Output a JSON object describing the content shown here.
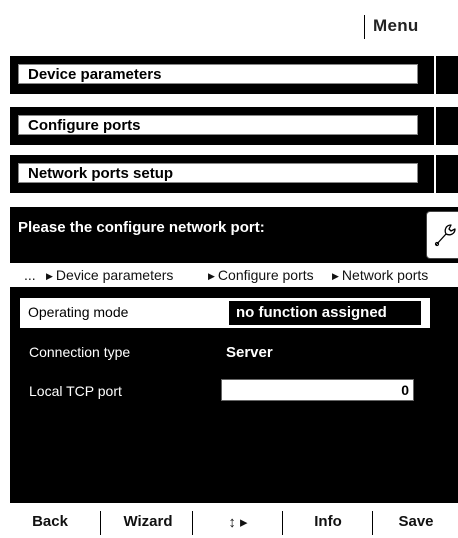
{
  "topbar": {
    "menu_label": "Menu"
  },
  "nav": [
    {
      "label": "Device parameters"
    },
    {
      "label": "Configure ports"
    },
    {
      "label": "Network ports setup"
    }
  ],
  "panel": {
    "prompt": "Please the configure network port:",
    "breadcrumb": {
      "ellipsis": "...",
      "items": [
        "Device parameters",
        "Configure ports",
        "Network ports"
      ]
    },
    "fields": [
      {
        "label": "Operating mode",
        "value": "no function assigned"
      },
      {
        "label": "Connection type",
        "value": "Server"
      },
      {
        "label": "Local TCP port",
        "value": "0"
      }
    ]
  },
  "bottombar": {
    "back": "Back",
    "wizard": "Wizard",
    "nav": "↕ ▸",
    "info": "Info",
    "save": "Save"
  },
  "icons": {
    "settings": "wrench-icon",
    "breadcrumb_separator": "triangle-right-icon"
  }
}
